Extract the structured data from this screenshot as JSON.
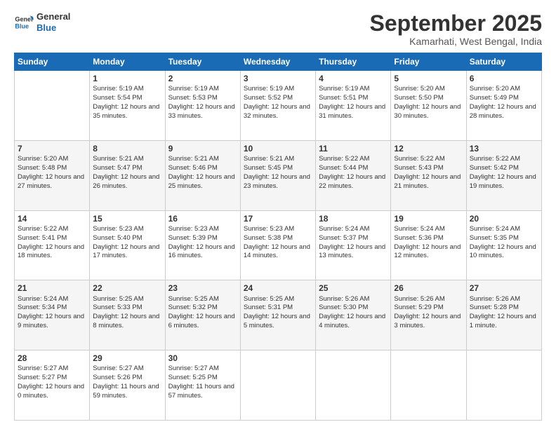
{
  "logo": {
    "line1": "General",
    "line2": "Blue"
  },
  "title": "September 2025",
  "location": "Kamarhati, West Bengal, India",
  "days_header": [
    "Sunday",
    "Monday",
    "Tuesday",
    "Wednesday",
    "Thursday",
    "Friday",
    "Saturday"
  ],
  "weeks": [
    [
      {
        "day": "",
        "sunrise": "",
        "sunset": "",
        "daylight": ""
      },
      {
        "day": "1",
        "sunrise": "Sunrise: 5:19 AM",
        "sunset": "Sunset: 5:54 PM",
        "daylight": "Daylight: 12 hours and 35 minutes."
      },
      {
        "day": "2",
        "sunrise": "Sunrise: 5:19 AM",
        "sunset": "Sunset: 5:53 PM",
        "daylight": "Daylight: 12 hours and 33 minutes."
      },
      {
        "day": "3",
        "sunrise": "Sunrise: 5:19 AM",
        "sunset": "Sunset: 5:52 PM",
        "daylight": "Daylight: 12 hours and 32 minutes."
      },
      {
        "day": "4",
        "sunrise": "Sunrise: 5:19 AM",
        "sunset": "Sunset: 5:51 PM",
        "daylight": "Daylight: 12 hours and 31 minutes."
      },
      {
        "day": "5",
        "sunrise": "Sunrise: 5:20 AM",
        "sunset": "Sunset: 5:50 PM",
        "daylight": "Daylight: 12 hours and 30 minutes."
      },
      {
        "day": "6",
        "sunrise": "Sunrise: 5:20 AM",
        "sunset": "Sunset: 5:49 PM",
        "daylight": "Daylight: 12 hours and 28 minutes."
      }
    ],
    [
      {
        "day": "7",
        "sunrise": "Sunrise: 5:20 AM",
        "sunset": "Sunset: 5:48 PM",
        "daylight": "Daylight: 12 hours and 27 minutes."
      },
      {
        "day": "8",
        "sunrise": "Sunrise: 5:21 AM",
        "sunset": "Sunset: 5:47 PM",
        "daylight": "Daylight: 12 hours and 26 minutes."
      },
      {
        "day": "9",
        "sunrise": "Sunrise: 5:21 AM",
        "sunset": "Sunset: 5:46 PM",
        "daylight": "Daylight: 12 hours and 25 minutes."
      },
      {
        "day": "10",
        "sunrise": "Sunrise: 5:21 AM",
        "sunset": "Sunset: 5:45 PM",
        "daylight": "Daylight: 12 hours and 23 minutes."
      },
      {
        "day": "11",
        "sunrise": "Sunrise: 5:22 AM",
        "sunset": "Sunset: 5:44 PM",
        "daylight": "Daylight: 12 hours and 22 minutes."
      },
      {
        "day": "12",
        "sunrise": "Sunrise: 5:22 AM",
        "sunset": "Sunset: 5:43 PM",
        "daylight": "Daylight: 12 hours and 21 minutes."
      },
      {
        "day": "13",
        "sunrise": "Sunrise: 5:22 AM",
        "sunset": "Sunset: 5:42 PM",
        "daylight": "Daylight: 12 hours and 19 minutes."
      }
    ],
    [
      {
        "day": "14",
        "sunrise": "Sunrise: 5:22 AM",
        "sunset": "Sunset: 5:41 PM",
        "daylight": "Daylight: 12 hours and 18 minutes."
      },
      {
        "day": "15",
        "sunrise": "Sunrise: 5:23 AM",
        "sunset": "Sunset: 5:40 PM",
        "daylight": "Daylight: 12 hours and 17 minutes."
      },
      {
        "day": "16",
        "sunrise": "Sunrise: 5:23 AM",
        "sunset": "Sunset: 5:39 PM",
        "daylight": "Daylight: 12 hours and 16 minutes."
      },
      {
        "day": "17",
        "sunrise": "Sunrise: 5:23 AM",
        "sunset": "Sunset: 5:38 PM",
        "daylight": "Daylight: 12 hours and 14 minutes."
      },
      {
        "day": "18",
        "sunrise": "Sunrise: 5:24 AM",
        "sunset": "Sunset: 5:37 PM",
        "daylight": "Daylight: 12 hours and 13 minutes."
      },
      {
        "day": "19",
        "sunrise": "Sunrise: 5:24 AM",
        "sunset": "Sunset: 5:36 PM",
        "daylight": "Daylight: 12 hours and 12 minutes."
      },
      {
        "day": "20",
        "sunrise": "Sunrise: 5:24 AM",
        "sunset": "Sunset: 5:35 PM",
        "daylight": "Daylight: 12 hours and 10 minutes."
      }
    ],
    [
      {
        "day": "21",
        "sunrise": "Sunrise: 5:24 AM",
        "sunset": "Sunset: 5:34 PM",
        "daylight": "Daylight: 12 hours and 9 minutes."
      },
      {
        "day": "22",
        "sunrise": "Sunrise: 5:25 AM",
        "sunset": "Sunset: 5:33 PM",
        "daylight": "Daylight: 12 hours and 8 minutes."
      },
      {
        "day": "23",
        "sunrise": "Sunrise: 5:25 AM",
        "sunset": "Sunset: 5:32 PM",
        "daylight": "Daylight: 12 hours and 6 minutes."
      },
      {
        "day": "24",
        "sunrise": "Sunrise: 5:25 AM",
        "sunset": "Sunset: 5:31 PM",
        "daylight": "Daylight: 12 hours and 5 minutes."
      },
      {
        "day": "25",
        "sunrise": "Sunrise: 5:26 AM",
        "sunset": "Sunset: 5:30 PM",
        "daylight": "Daylight: 12 hours and 4 minutes."
      },
      {
        "day": "26",
        "sunrise": "Sunrise: 5:26 AM",
        "sunset": "Sunset: 5:29 PM",
        "daylight": "Daylight: 12 hours and 3 minutes."
      },
      {
        "day": "27",
        "sunrise": "Sunrise: 5:26 AM",
        "sunset": "Sunset: 5:28 PM",
        "daylight": "Daylight: 12 hours and 1 minute."
      }
    ],
    [
      {
        "day": "28",
        "sunrise": "Sunrise: 5:27 AM",
        "sunset": "Sunset: 5:27 PM",
        "daylight": "Daylight: 12 hours and 0 minutes."
      },
      {
        "day": "29",
        "sunrise": "Sunrise: 5:27 AM",
        "sunset": "Sunset: 5:26 PM",
        "daylight": "Daylight: 11 hours and 59 minutes."
      },
      {
        "day": "30",
        "sunrise": "Sunrise: 5:27 AM",
        "sunset": "Sunset: 5:25 PM",
        "daylight": "Daylight: 11 hours and 57 minutes."
      },
      {
        "day": "",
        "sunrise": "",
        "sunset": "",
        "daylight": ""
      },
      {
        "day": "",
        "sunrise": "",
        "sunset": "",
        "daylight": ""
      },
      {
        "day": "",
        "sunrise": "",
        "sunset": "",
        "daylight": ""
      },
      {
        "day": "",
        "sunrise": "",
        "sunset": "",
        "daylight": ""
      }
    ]
  ]
}
